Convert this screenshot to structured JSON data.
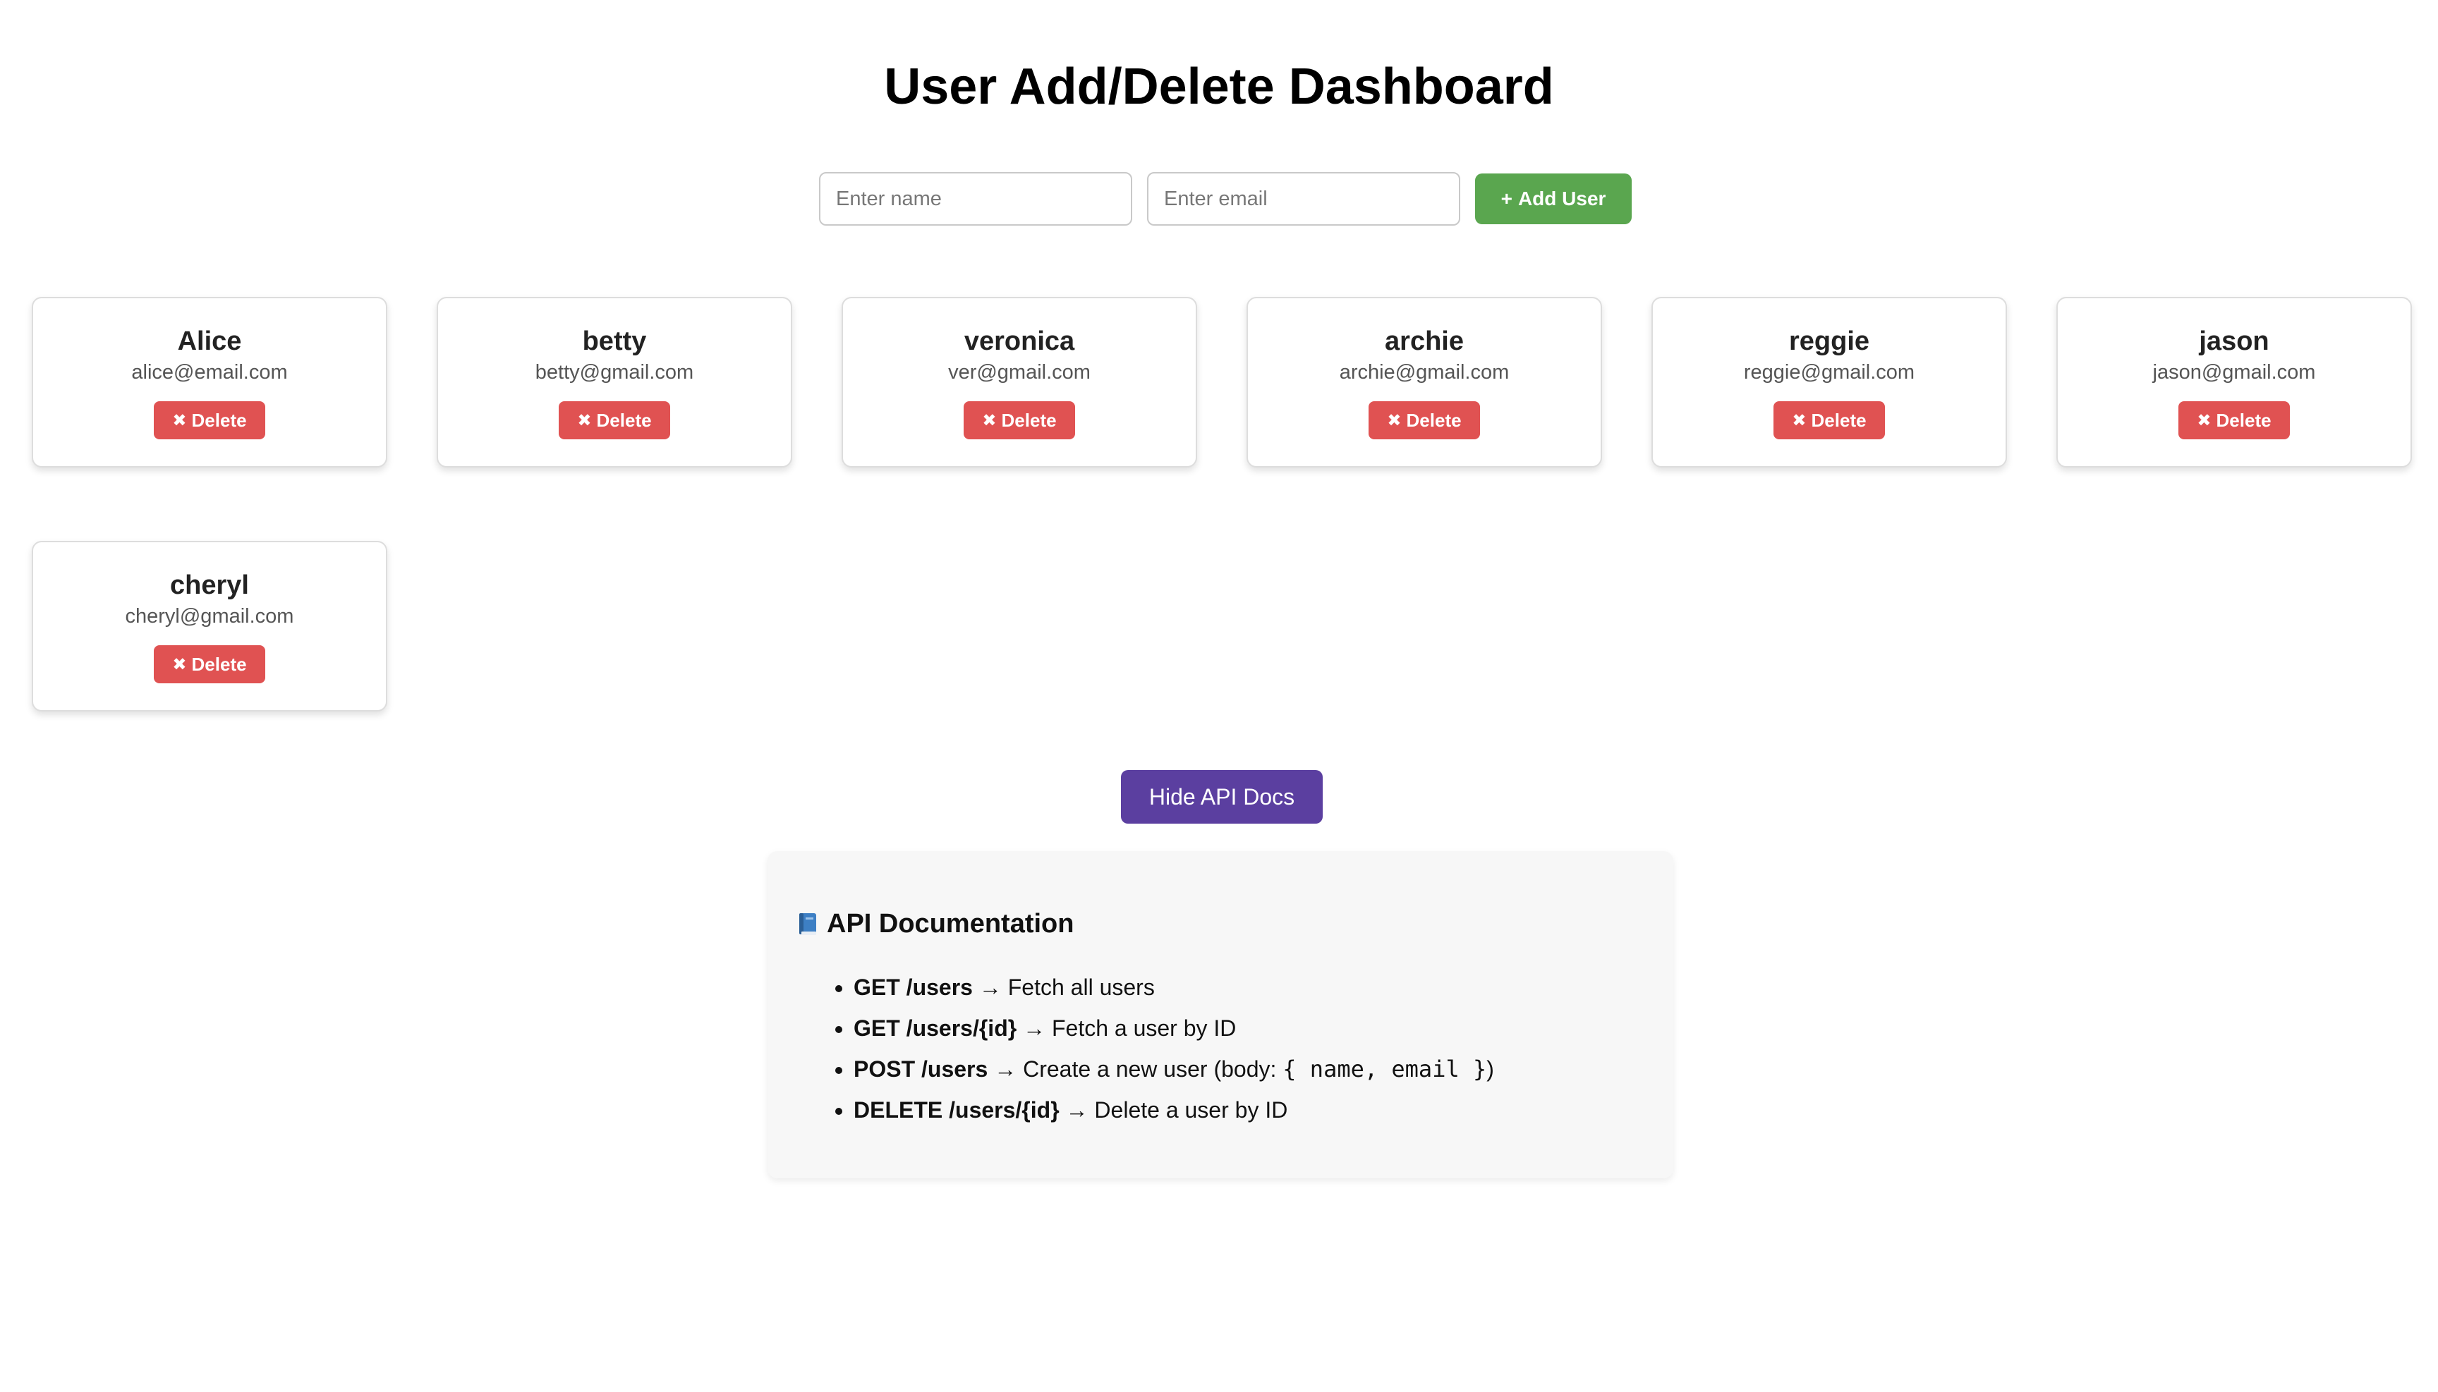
{
  "page": {
    "title": "User Add/Delete Dashboard"
  },
  "form": {
    "name_placeholder": "Enter name",
    "name_value": "",
    "email_placeholder": "Enter email",
    "email_value": "",
    "add_icon": "+",
    "add_label": "Add User",
    "add_color": "#5aa64f"
  },
  "users": [
    {
      "name": "Alice",
      "email": "alice@email.com"
    },
    {
      "name": "betty",
      "email": "betty@gmail.com"
    },
    {
      "name": "veronica",
      "email": "ver@gmail.com"
    },
    {
      "name": "archie",
      "email": "archie@gmail.com"
    },
    {
      "name": "reggie",
      "email": "reggie@gmail.com"
    },
    {
      "name": "jason",
      "email": "jason@gmail.com"
    },
    {
      "name": "cheryl",
      "email": "cheryl@gmail.com"
    }
  ],
  "user_card": {
    "delete_icon": "✖",
    "delete_label": "Delete",
    "delete_color": "#e05252"
  },
  "docs_toggle": {
    "label": "Hide API Docs",
    "color": "#5b3fa0"
  },
  "docs": {
    "icon": "book-icon",
    "title": "API Documentation",
    "endpoints": [
      {
        "method": "GET /users",
        "arrow": "→",
        "desc": "Fetch all users",
        "code": "",
        "desc_after": ""
      },
      {
        "method": "GET /users/{id}",
        "arrow": "→",
        "desc": "Fetch a user by ID",
        "code": "",
        "desc_after": ""
      },
      {
        "method": "POST /users",
        "arrow": "→",
        "desc": "Create a new user (body: ",
        "code": "{ name, email }",
        "desc_after": ")"
      },
      {
        "method": "DELETE /users/{id}",
        "arrow": "→",
        "desc": "Delete a user by ID",
        "code": "",
        "desc_after": ""
      }
    ]
  }
}
